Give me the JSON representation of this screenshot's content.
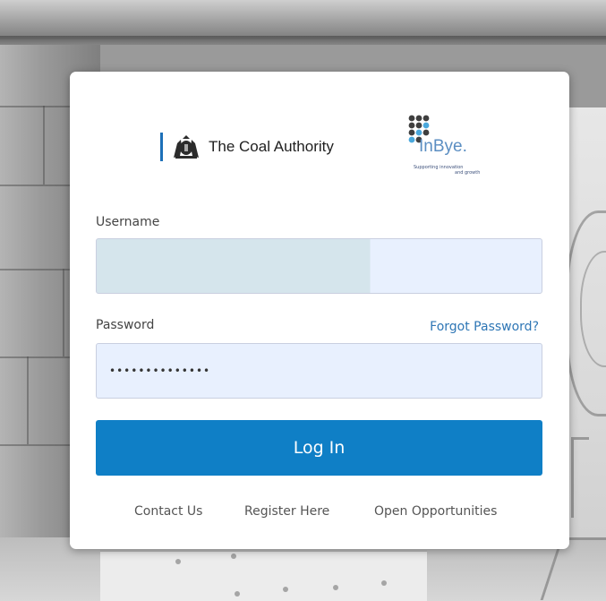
{
  "brand": {
    "coal_authority_name": "The Coal Authority",
    "inbye_name": "InBye.",
    "inbye_tagline_1": "Supporting innovation",
    "inbye_tagline_2": "and growth",
    "accent_color": "#1d70b8"
  },
  "form": {
    "username_label": "Username",
    "username_value": "",
    "password_label": "Password",
    "password_value": "••••••••••••••",
    "forgot_password_label": "Forgot Password?",
    "login_button_label": "Log In",
    "button_color": "#0f7fc6",
    "link_color": "#2e76b5"
  },
  "footer": {
    "contact_label": "Contact Us",
    "register_label": "Register Here",
    "opportunities_label": "Open Opportunities"
  },
  "icons": {
    "crest": "royal-crest-icon",
    "inbye_logo": "inbye-dots-logo"
  }
}
